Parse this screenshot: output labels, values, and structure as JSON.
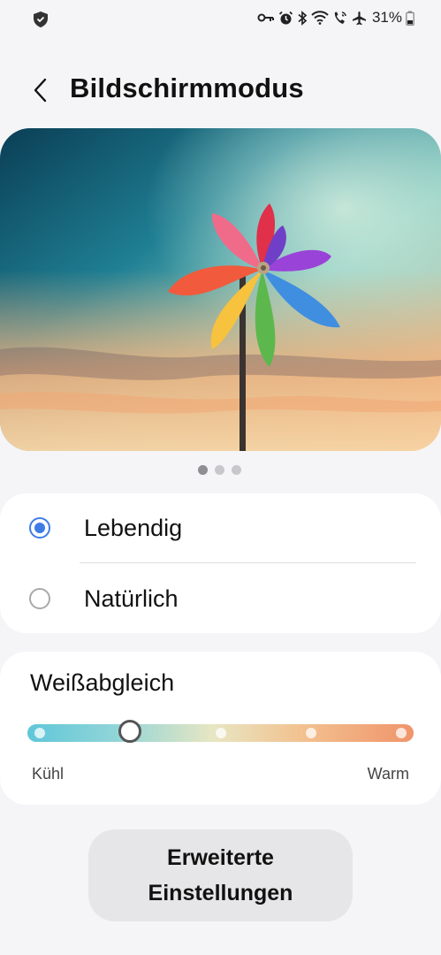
{
  "status_bar": {
    "battery": "31%",
    "icons": [
      "vpn-key-icon",
      "alarm-icon",
      "bluetooth-icon",
      "wifi-icon",
      "wifi-calling-icon",
      "airplane-icon",
      "battery-icon"
    ],
    "left_icon": "shield-icon"
  },
  "header": {
    "title": "Bildschirmmodus",
    "back_icon": "chevron-left-icon"
  },
  "preview": {
    "pages": 3,
    "active_page": 1
  },
  "screen_mode": {
    "options": [
      {
        "label": "Lebendig",
        "selected": true
      },
      {
        "label": "Natürlich",
        "selected": false
      }
    ]
  },
  "white_balance": {
    "title": "Weißabgleich",
    "min_label": "Kühl",
    "max_label": "Warm",
    "steps": 5,
    "value_step": 2,
    "accent": "#3e7de6"
  },
  "advanced_button": {
    "line1": "Erweiterte",
    "line2": "Einstellungen"
  }
}
